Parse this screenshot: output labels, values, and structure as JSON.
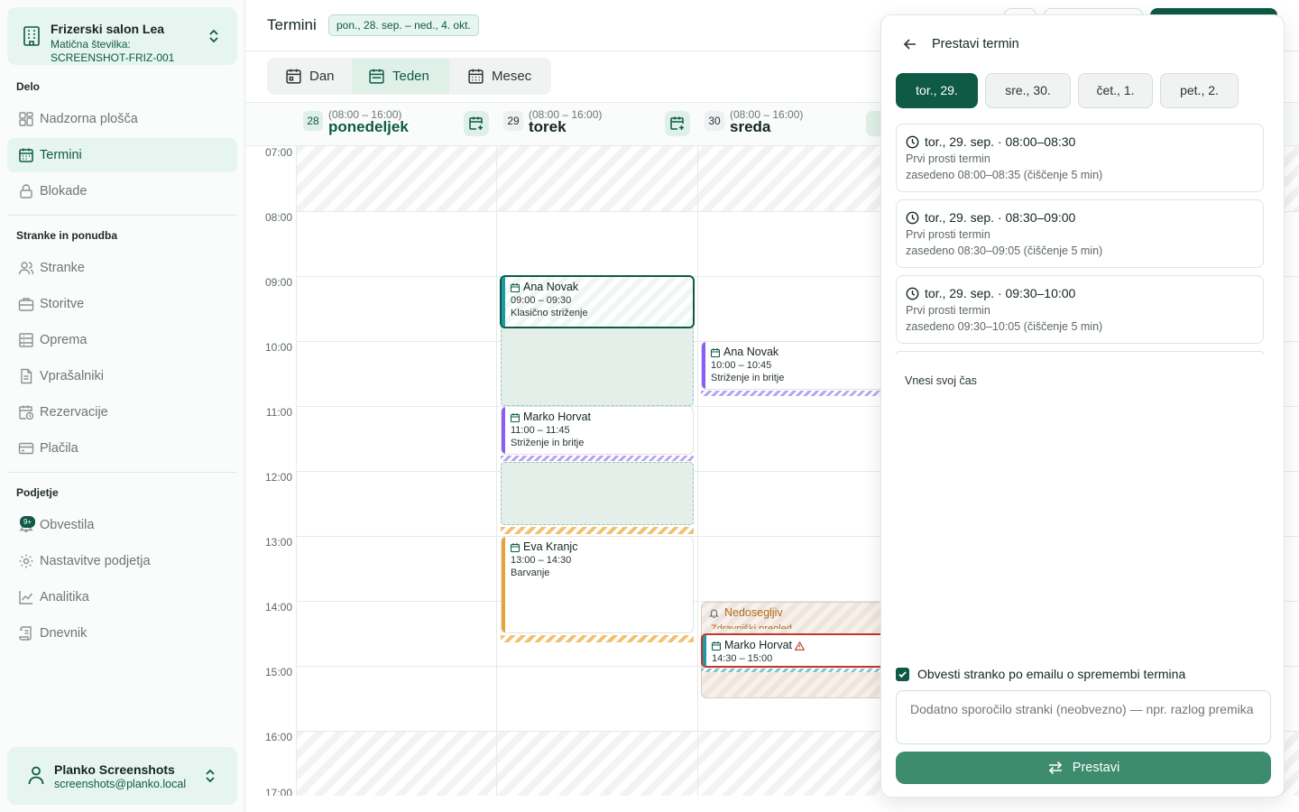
{
  "org": {
    "name": "Frizerski salon Lea",
    "id_label": "Matična številka:",
    "id_value": "SCREENSHOT-FRIZ-001"
  },
  "sidebar": {
    "sections": [
      "Delo",
      "Stranke in ponudba",
      "Podjetje"
    ],
    "items": [
      {
        "label": "Nadzorna plošča",
        "icon": "dashboard-icon"
      },
      {
        "label": "Termini",
        "icon": "calendar-icon",
        "active": true
      },
      {
        "label": "Blokade",
        "icon": "lock-icon"
      },
      {
        "label": "Stranke",
        "icon": "users-icon"
      },
      {
        "label": "Storitve",
        "icon": "briefcase-icon"
      },
      {
        "label": "Oprema",
        "icon": "equipment-icon"
      },
      {
        "label": "Vprašalniki",
        "icon": "document-icon"
      },
      {
        "label": "Rezervacije",
        "icon": "calendar-clock-icon"
      },
      {
        "label": "Plačila",
        "icon": "credit-card-icon"
      },
      {
        "label": "Obvestila",
        "icon": "bell-icon",
        "badge": "9+"
      },
      {
        "label": "Nastavitve podjetja",
        "icon": "gear-icon"
      },
      {
        "label": "Analitika",
        "icon": "chart-icon"
      },
      {
        "label": "Dnevnik",
        "icon": "scroll-icon"
      }
    ]
  },
  "user": {
    "name": "Planko Screenshots",
    "email": "screenshots@planko.local"
  },
  "header": {
    "title": "Termini",
    "range": "pon., 28. sep. – ned., 4. okt."
  },
  "views": [
    {
      "label": "Dan"
    },
    {
      "label": "Teden",
      "active": true
    },
    {
      "label": "Mesec"
    }
  ],
  "days": [
    {
      "num": "28",
      "hours": "(08:00 – 16:00)",
      "name": "ponedeljek",
      "today": true
    },
    {
      "num": "29",
      "hours": "(08:00 – 16:00)",
      "name": "torek"
    },
    {
      "num": "30",
      "hours": "(08:00 – 16:00)",
      "name": "sreda"
    }
  ],
  "times": [
    "07:00",
    "08:00",
    "09:00",
    "10:00",
    "11:00",
    "12:00",
    "13:00",
    "14:00",
    "15:00",
    "16:00",
    "17:00"
  ],
  "events": [
    {
      "name": "Ana Novak",
      "time": "09:00 – 09:30",
      "service": "Klasično striženje"
    },
    {
      "name": "Marko Horvat",
      "time": "11:00 – 11:45",
      "service": "Striženje in britje"
    },
    {
      "name": "Eva Kranjc",
      "time": "13:00 – 14:30",
      "service": "Barvanje"
    },
    {
      "name": "Ana Novak",
      "time": "10:00 – 10:45",
      "service": "Striženje in britje"
    },
    {
      "name": "Marko Horvat",
      "time": "14:30 – 15:00"
    }
  ],
  "unavailable": {
    "label": "Nedosegljiv",
    "sub": "Zdravniški pregled"
  },
  "colors": {
    "primary": "#0e5a45",
    "accent_green": "#3d8c70",
    "purple": "#8b5cf6",
    "orange": "#e8a23a",
    "teal": "#1a9aa8",
    "red": "#c0392b"
  },
  "panel": {
    "title": "Prestavi termin",
    "day_chips": [
      {
        "label": "tor., 29.",
        "active": true
      },
      {
        "label": "sre., 30."
      },
      {
        "label": "čet., 1."
      },
      {
        "label": "pet., 2."
      }
    ],
    "slots": [
      {
        "head": "tor., 29. sep. · 08:00–08:30",
        "l2": "Prvi prosti termin",
        "l3": "zasedeno 08:00–08:35 (čiščenje 5 min)"
      },
      {
        "head": "tor., 29. sep. · 08:30–09:00",
        "l2": "Prvi prosti termin",
        "l3": "zasedeno 08:30–09:05 (čiščenje 5 min)"
      },
      {
        "head": "tor., 29. sep. · 09:30–10:00",
        "l2": "Prvi prosti termin",
        "l3": "zasedeno 09:30–10:05 (čiščenje 5 min)"
      }
    ],
    "custom_time": "Vnesi svoj čas",
    "notify_label": "Obvesti stranko po emailu o spremembi termina",
    "message_placeholder": "Dodatno sporočilo stranki (neobvezno) — npr. razlog premika",
    "submit_label": "Prestavi"
  }
}
